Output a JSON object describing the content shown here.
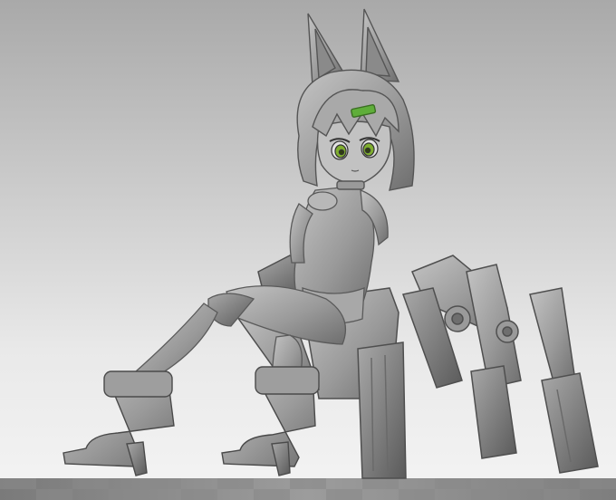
{
  "scene": {
    "subject": "sculpt-figure",
    "accent_colors": {
      "eye_green": "#7fae2f",
      "hair_clip_green": "#5fae3a",
      "clay": "#8e8e8e",
      "clay_light": "#bdbdbd",
      "clay_dark": "#5e5e5e"
    },
    "icons": [
      "fox-ears-icon",
      "hair-clip-icon",
      "mech-leg-icon"
    ]
  }
}
